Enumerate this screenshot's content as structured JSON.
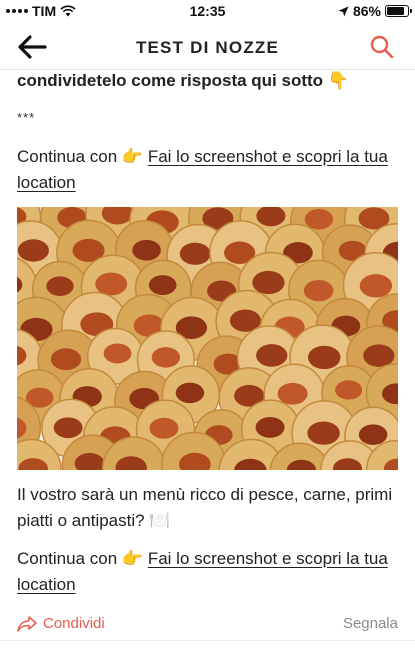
{
  "status": {
    "carrier": "TIM",
    "time": "12:35",
    "battery": "86%",
    "battery_level": 0.86
  },
  "nav": {
    "title": "TEST DI NOZZE"
  },
  "post": {
    "lead": "condividetelo come risposta qui sotto",
    "lead_emoji": "👇",
    "separator": "***",
    "continue_prefix": "Continua con",
    "pointer_emoji": "👉",
    "link": "Fai lo screenshot e scopri la tua location",
    "question": "Il vostro sarà un menù ricco di pesce, carne, primi piatti o antipasti?",
    "question_emoji": "🍽️"
  },
  "footer": {
    "share": "Condividi",
    "report": "Segnala"
  }
}
